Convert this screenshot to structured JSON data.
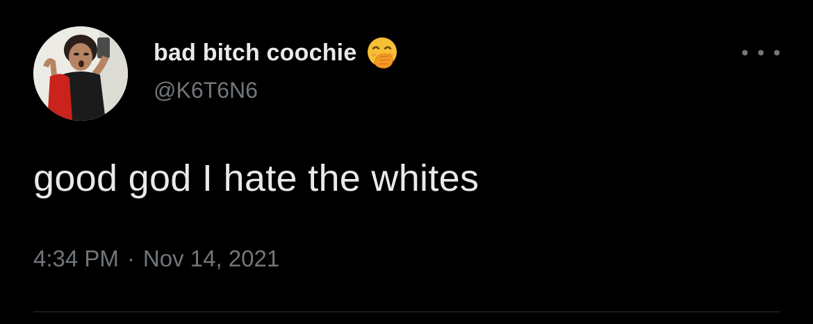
{
  "colors": {
    "background": "#000000",
    "primary_text": "#e7e9ea",
    "secondary_text": "#71767b",
    "divider": "#2f3336"
  },
  "tweet": {
    "author": {
      "display_name": "bad bitch coochie",
      "name_emoji": "face-with-hand-over-mouth-emoji",
      "handle": "@K6T6N6",
      "avatar_icon": "avatar"
    },
    "text": "good god I hate the whites",
    "time": "4:34 PM",
    "separator": "·",
    "date": "Nov 14, 2021",
    "more_icon": "more-options-icon"
  }
}
